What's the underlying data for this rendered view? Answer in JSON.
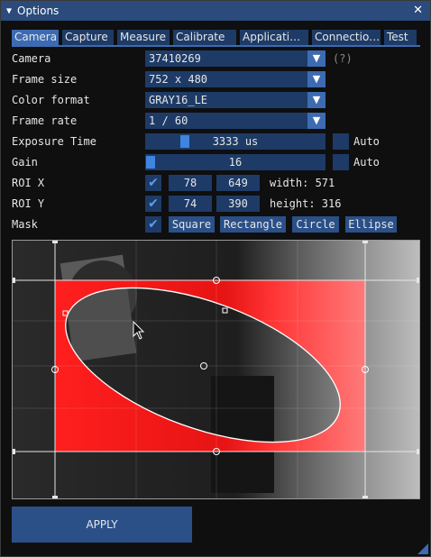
{
  "window": {
    "title": "Options",
    "collapse_icon": "triangle-down-icon",
    "close_label": "✕"
  },
  "tabs": [
    {
      "label": "Camera",
      "active": true
    },
    {
      "label": "Capture"
    },
    {
      "label": "Measure"
    },
    {
      "label": "Calibrate"
    },
    {
      "label": "Applicati…"
    },
    {
      "label": "Connectio…"
    },
    {
      "label": "Test"
    }
  ],
  "camera": {
    "label": "Camera",
    "value": "37410269",
    "help": "(?)"
  },
  "frame_size": {
    "label": "Frame size",
    "value": "752 x 480"
  },
  "color_format": {
    "label": "Color format",
    "value": "GRAY16_LE"
  },
  "frame_rate": {
    "label": "Frame rate",
    "value": "1 / 60"
  },
  "exposure": {
    "label": "Exposure Time",
    "value": "3333 us",
    "fraction": 0.2,
    "auto_label": "Auto",
    "auto": false
  },
  "gain": {
    "label": "Gain",
    "value": "16",
    "fraction": 0.0,
    "auto_label": "Auto",
    "auto": false
  },
  "roi_x": {
    "label": "ROI X",
    "checked": true,
    "min": "78",
    "max": "649",
    "info": "width: 571"
  },
  "roi_y": {
    "label": "ROI Y",
    "checked": true,
    "min": "74",
    "max": "390",
    "info": "height: 316"
  },
  "mask": {
    "label": "Mask",
    "checked": true,
    "buttons": [
      "Square",
      "Rectangle",
      "Circle",
      "Ellipse"
    ]
  },
  "apply_label": "APPLY",
  "colors": {
    "accent": "#3c6bb2",
    "frame": "#1d3b66",
    "mask": "#ff2a2a"
  }
}
